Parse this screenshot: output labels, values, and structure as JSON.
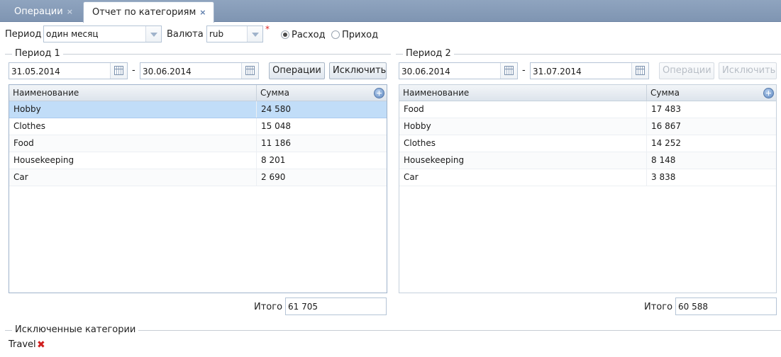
{
  "tabs": [
    {
      "label": "Операции",
      "close": "×"
    },
    {
      "label": "Отчет по категориям",
      "close": "×"
    }
  ],
  "toolbar": {
    "period_label": "Период",
    "period_value": "один месяц",
    "currency_label": "Валюта",
    "currency_value": "rub",
    "required_mark": "*",
    "radio_expense": "Расход",
    "radio_income": "Приход",
    "selected_radio": "expense"
  },
  "period1": {
    "legend": "Период 1",
    "date_from": "31.05.2014",
    "date_to": "30.06.2014",
    "dash": "-",
    "btn_operations": "Операции",
    "btn_exclude": "Исключить",
    "columns": [
      "Наименование",
      "Сумма"
    ],
    "rows": [
      {
        "name": "Hobby",
        "sum": "24 580"
      },
      {
        "name": "Clothes",
        "sum": "15 048"
      },
      {
        "name": "Food",
        "sum": "11 186"
      },
      {
        "name": "Housekeeping",
        "sum": "8 201"
      },
      {
        "name": "Car",
        "sum": "2 690"
      }
    ],
    "total_label": "Итого",
    "total_value": "61 705"
  },
  "period2": {
    "legend": "Период 2",
    "date_from": "30.06.2014",
    "date_to": "31.07.2014",
    "dash": "-",
    "btn_operations": "Операции",
    "btn_exclude": "Исключить",
    "columns": [
      "Наименование",
      "Сумма"
    ],
    "rows": [
      {
        "name": "Food",
        "sum": "17 483"
      },
      {
        "name": "Hobby",
        "sum": "16 867"
      },
      {
        "name": "Clothes",
        "sum": "14 252"
      },
      {
        "name": "Housekeeping",
        "sum": "8 148"
      },
      {
        "name": "Car",
        "sum": "3 838"
      }
    ],
    "total_label": "Итого",
    "total_value": "60 588"
  },
  "excluded": {
    "legend": "Исключенные категории",
    "items": [
      "Travel"
    ],
    "remove_glyph": "✖"
  },
  "colors": {
    "tabbar": "#7f95b2",
    "selected_row": "#c1ddf8",
    "remove_icon": "#d01f1f"
  }
}
